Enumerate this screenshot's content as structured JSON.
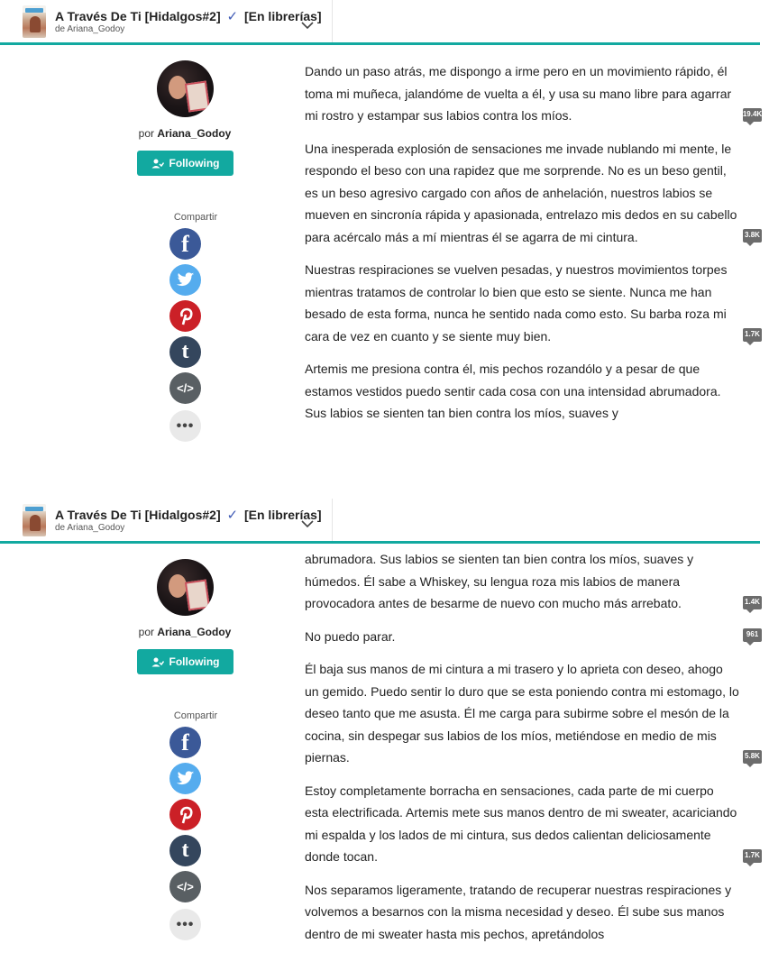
{
  "story": {
    "title": "A Través De Ti [Hidalgos#2]",
    "check": "✓",
    "status": "[En librerías]",
    "byline": "de Ariana_Godoy"
  },
  "author": {
    "prefix": "por",
    "name": "Ariana_Godoy",
    "follow_label": "Following"
  },
  "share": {
    "label": "Compartir",
    "icons": [
      "facebook-icon",
      "twitter-icon",
      "pinterest-icon",
      "tumblr-icon",
      "embed-icon",
      "more-icon"
    ],
    "glyphs": {
      "facebook": "f",
      "tumblr": "t",
      "embed": "</>",
      "more": "•••"
    }
  },
  "colors": {
    "accent": "#12a9a0",
    "facebook": "#3b5998",
    "twitter": "#55acee",
    "pinterest": "#cb2027",
    "tumblr": "#34465d",
    "badge": "#6c6c6c"
  },
  "top": {
    "paragraphs": [
      {
        "text": "Dando un paso atrás, me dispongo a irme pero en un movimiento rápido, él toma mi muñeca, jalandóme de vuelta a él, y usa su mano libre para agarrar mi rostro y estampar sus labios contra los míos.",
        "comments": "19.4K"
      },
      {
        "text": "Una inesperada explosión de sensaciones me invade nublando mi mente, le respondo el beso con una rapidez que me sorprende. No es un beso gentil, es un beso agresivo cargado con años de anhelación, nuestros labios se mueven en sincronía rápida y apasionada, entrelazo mis dedos en su cabello para acércalo más a mí mientras él se agarra de mi cintura.",
        "comments": "3.8K"
      },
      {
        "text": "Nuestras respiraciones se vuelven pesadas, y nuestros movimientos torpes mientras tratamos de controlar lo bien que esto se siente. Nunca me han besado de esta forma, nunca he sentido nada como esto. Su barba roza mi cara de vez en cuanto y se siente muy bien.",
        "comments": "1.7K"
      },
      {
        "text": "Artemis me presiona contra él, mis pechos rozandólo y a pesar de que estamos vestidos puedo sentir cada cosa con una intensidad abrumadora. Sus labios se sienten tan bien contra los míos, suaves y",
        "comments": ""
      }
    ]
  },
  "bottom": {
    "paragraphs": [
      {
        "text": "abrumadora. Sus labios se sienten tan bien contra los míos, suaves y húmedos. Él sabe a Whiskey, su lengua roza mis labios de manera provocadora antes de besarme de nuevo con mucho más arrebato.",
        "comments": "1.4K"
      },
      {
        "text": "No puedo parar.",
        "comments": "961"
      },
      {
        "text": "Él baja sus manos de mi cintura a mi trasero y lo aprieta con deseo, ahogo un gemido. Puedo sentir lo duro que se esta poniendo contra mi estomago, lo deseo tanto que me asusta. Él me carga para subirme sobre el mesón de la cocina, sin despegar sus labios de los míos, metiéndose en medio de mis piernas.",
        "comments": "5.8K"
      },
      {
        "text": "Estoy completamente borracha en sensaciones, cada parte de mi cuerpo esta electrificada. Artemis mete sus manos dentro de mi sweater, acariciando mi espalda y los lados de mi cintura, sus dedos calientan deliciosamente donde tocan.",
        "comments": "1.7K"
      },
      {
        "text": "Nos separamos ligeramente, tratando de recuperar nuestras respiraciones y volvemos a besarnos con la misma necesidad y deseo. Él sube sus manos dentro de mi sweater hasta mis pechos, apretándolos",
        "comments": ""
      }
    ]
  }
}
